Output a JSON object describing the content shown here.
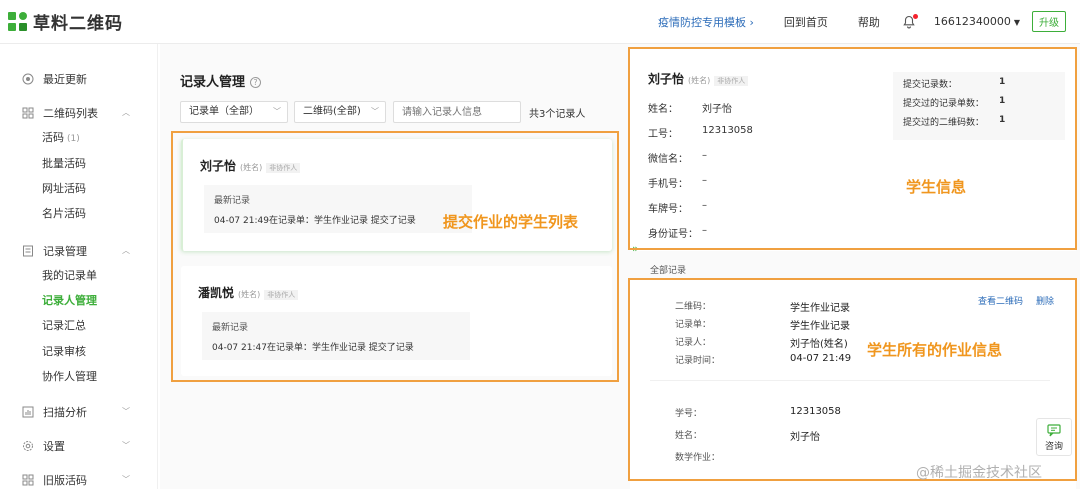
{
  "header": {
    "logo_text": "草料二维码",
    "nav": [
      "疫情防控专用模板 ›",
      "回到首页",
      "帮助"
    ],
    "user": "16612340000",
    "upgrade": "升级"
  },
  "sidebar": {
    "items": [
      {
        "label": "最近更新"
      },
      {
        "label": "二维码列表"
      },
      {
        "label": "活码",
        "badge": "(1)"
      },
      {
        "label": "批量活码"
      },
      {
        "label": "网址活码"
      },
      {
        "label": "名片活码"
      },
      {
        "label": "记录管理"
      },
      {
        "label": "我的记录单"
      },
      {
        "label": "记录人管理"
      },
      {
        "label": "记录汇总"
      },
      {
        "label": "记录审核"
      },
      {
        "label": "协作人管理"
      },
      {
        "label": "扫描分析"
      },
      {
        "label": "设置"
      },
      {
        "label": "旧版活码"
      }
    ]
  },
  "main": {
    "title": "记录人管理",
    "filter1": "记录单（全部）",
    "filter2": "二维码(全部)",
    "search_placeholder": "请输入记录人信息",
    "count": "共3个记录人",
    "cards": [
      {
        "name": "刘子怡",
        "sub": "(姓名)",
        "tag": "非协作人",
        "rec_label": "最新记录",
        "rec_text": "04-07 21:49在记录单：学生作业记录 提交了记录"
      },
      {
        "name": "潘凯悦",
        "sub": "(姓名)",
        "tag": "非协作人",
        "rec_label": "最新记录",
        "rec_text": "04-07 21:47在记录单：学生作业记录 提交了记录"
      }
    ]
  },
  "detail": {
    "name": "刘子怡",
    "sub": "(姓名)",
    "tag": "非协作人",
    "fields": [
      {
        "k": "姓名：",
        "v": "刘子怡"
      },
      {
        "k": "工号：",
        "v": "12313058"
      },
      {
        "k": "微信名：",
        "v": "–"
      },
      {
        "k": "手机号：",
        "v": "–"
      },
      {
        "k": "车牌号：",
        "v": "–"
      },
      {
        "k": "身份证号：",
        "v": "–"
      }
    ],
    "stats": [
      {
        "k": "提交记录数：",
        "v": "1"
      },
      {
        "k": "提交过的记录单数：",
        "v": "1"
      },
      {
        "k": "提交过的二维码数：",
        "v": "1"
      }
    ],
    "collapse_glyph": "»",
    "section_label": "全部记录",
    "record": [
      {
        "k": "二维码：",
        "v": "学生作业记录"
      },
      {
        "k": "记录单：",
        "v": "学生作业记录"
      },
      {
        "k": "记录人：",
        "v": "刘子怡(姓名)"
      },
      {
        "k": "记录时间：",
        "v": "04-07 21:49"
      }
    ],
    "record2": [
      {
        "k": "学号：",
        "v": "12313058"
      },
      {
        "k": "姓名：",
        "v": "刘子怡"
      },
      {
        "k": "数学作业：",
        "v": ""
      }
    ],
    "view_qr": "查看二维码",
    "delete": "删除"
  },
  "annotations": {
    "list": "提交作业的学生列表",
    "info": "学生信息",
    "homework": "学生所有的作业信息"
  },
  "consult": "咨询",
  "watermark": "@稀土掘金技术社区",
  "colors": {
    "brand": "#3dae3a",
    "annotation": "#f0a040",
    "link": "#2c6cb9"
  }
}
